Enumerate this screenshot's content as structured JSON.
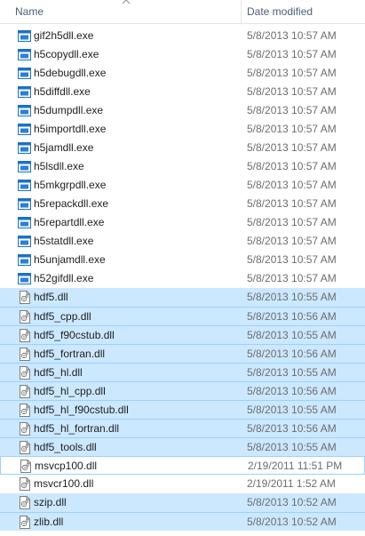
{
  "header": {
    "name_label": "Name",
    "date_label": "Date modified"
  },
  "colors": {
    "selected_bg": "#cce8ff",
    "selected_border": "#99d1ff",
    "exe_icon_blue": "#1f6fc9",
    "header_text": "#4c607a"
  },
  "files": [
    {
      "name": "gif2h5dll.exe",
      "date": "5/8/2013 10:57 AM",
      "icon": "exe-icon",
      "selected": false
    },
    {
      "name": "h5copydll.exe",
      "date": "5/8/2013 10:57 AM",
      "icon": "exe-icon",
      "selected": false
    },
    {
      "name": "h5debugdll.exe",
      "date": "5/8/2013 10:57 AM",
      "icon": "exe-icon",
      "selected": false
    },
    {
      "name": "h5diffdll.exe",
      "date": "5/8/2013 10:57 AM",
      "icon": "exe-icon",
      "selected": false
    },
    {
      "name": "h5dumpdll.exe",
      "date": "5/8/2013 10:57 AM",
      "icon": "exe-icon",
      "selected": false
    },
    {
      "name": "h5importdll.exe",
      "date": "5/8/2013 10:57 AM",
      "icon": "exe-icon",
      "selected": false
    },
    {
      "name": "h5jamdll.exe",
      "date": "5/8/2013 10:57 AM",
      "icon": "exe-icon",
      "selected": false
    },
    {
      "name": "h5lsdll.exe",
      "date": "5/8/2013 10:57 AM",
      "icon": "exe-icon",
      "selected": false
    },
    {
      "name": "h5mkgrpdll.exe",
      "date": "5/8/2013 10:57 AM",
      "icon": "exe-icon",
      "selected": false
    },
    {
      "name": "h5repackdll.exe",
      "date": "5/8/2013 10:57 AM",
      "icon": "exe-icon",
      "selected": false
    },
    {
      "name": "h5repartdll.exe",
      "date": "5/8/2013 10:57 AM",
      "icon": "exe-icon",
      "selected": false
    },
    {
      "name": "h5statdll.exe",
      "date": "5/8/2013 10:57 AM",
      "icon": "exe-icon",
      "selected": false
    },
    {
      "name": "h5unjamdll.exe",
      "date": "5/8/2013 10:57 AM",
      "icon": "exe-icon",
      "selected": false
    },
    {
      "name": "h52gifdll.exe",
      "date": "5/8/2013 10:57 AM",
      "icon": "exe-icon",
      "selected": false
    },
    {
      "name": "hdf5.dll",
      "date": "5/8/2013 10:55 AM",
      "icon": "dll-icon",
      "selected": true
    },
    {
      "name": "hdf5_cpp.dll",
      "date": "5/8/2013 10:56 AM",
      "icon": "dll-icon",
      "selected": true
    },
    {
      "name": "hdf5_f90cstub.dll",
      "date": "5/8/2013 10:55 AM",
      "icon": "dll-icon",
      "selected": true
    },
    {
      "name": "hdf5_fortran.dll",
      "date": "5/8/2013 10:56 AM",
      "icon": "dll-icon",
      "selected": true
    },
    {
      "name": "hdf5_hl.dll",
      "date": "5/8/2013 10:55 AM",
      "icon": "dll-icon",
      "selected": true
    },
    {
      "name": "hdf5_hl_cpp.dll",
      "date": "5/8/2013 10:56 AM",
      "icon": "dll-icon",
      "selected": true
    },
    {
      "name": "hdf5_hl_f90cstub.dll",
      "date": "5/8/2013 10:55 AM",
      "icon": "dll-icon",
      "selected": true
    },
    {
      "name": "hdf5_hl_fortran.dll",
      "date": "5/8/2013 10:56 AM",
      "icon": "dll-icon",
      "selected": true
    },
    {
      "name": "hdf5_tools.dll",
      "date": "5/8/2013 10:55 AM",
      "icon": "dll-icon",
      "selected": true
    },
    {
      "name": "msvcp100.dll",
      "date": "2/19/2011 11:51 PM",
      "icon": "dll-icon",
      "selected": false,
      "focus": true
    },
    {
      "name": "msvcr100.dll",
      "date": "2/19/2011 1:52 AM",
      "icon": "dll-icon",
      "selected": false
    },
    {
      "name": "szip.dll",
      "date": "5/8/2013 10:52 AM",
      "icon": "dll-icon",
      "selected": true
    },
    {
      "name": "zlib.dll",
      "date": "5/8/2013 10:52 AM",
      "icon": "dll-icon",
      "selected": true
    }
  ]
}
